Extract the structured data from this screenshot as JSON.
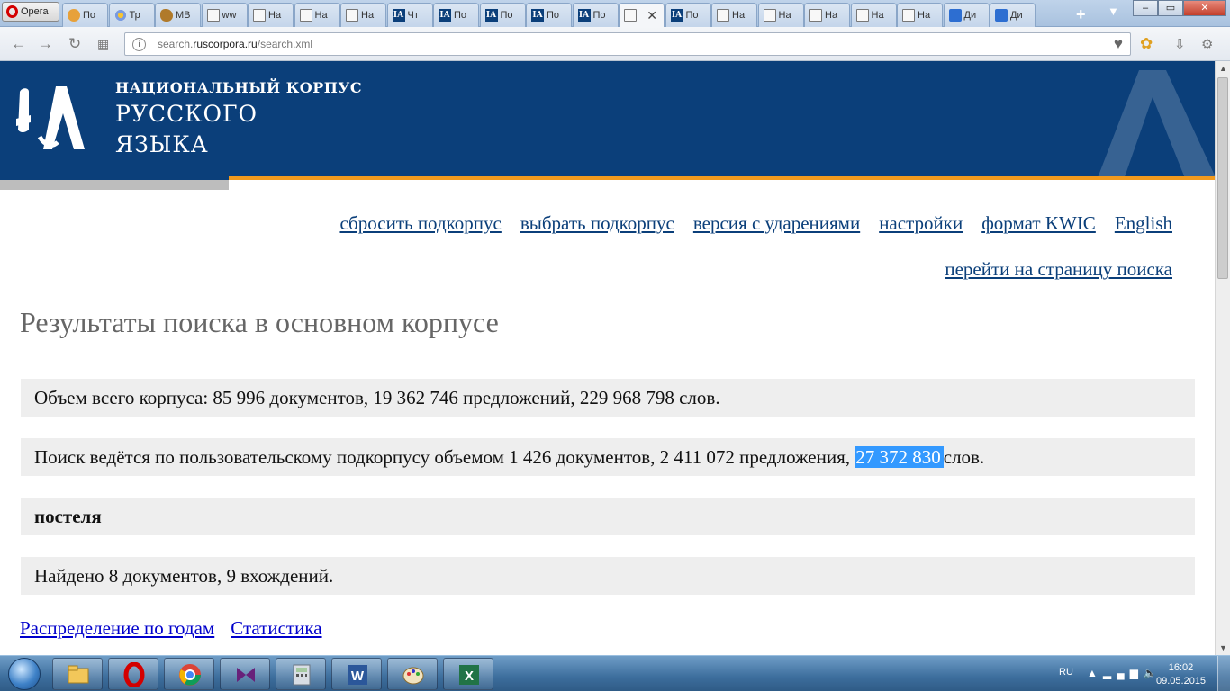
{
  "browser": {
    "menu_label": "Opera",
    "tabs": [
      {
        "title": "По",
        "icon": "orange"
      },
      {
        "title": "Тр",
        "icon": "flower"
      },
      {
        "title": "МВ",
        "icon": "squirrel"
      },
      {
        "title": "ww",
        "icon": "page"
      },
      {
        "title": "На",
        "icon": "page"
      },
      {
        "title": "На",
        "icon": "page"
      },
      {
        "title": "На",
        "icon": "page"
      },
      {
        "title": "Чт",
        "icon": "ruscorp"
      },
      {
        "title": "По",
        "icon": "ruscorp"
      },
      {
        "title": "По",
        "icon": "ruscorp"
      },
      {
        "title": "По",
        "icon": "ruscorp"
      },
      {
        "title": "По",
        "icon": "ruscorp"
      },
      {
        "title": "",
        "icon": "page",
        "active": true
      },
      {
        "title": "По",
        "icon": "ruscorp"
      },
      {
        "title": "На",
        "icon": "page"
      },
      {
        "title": "На",
        "icon": "page"
      },
      {
        "title": "На",
        "icon": "page"
      },
      {
        "title": "На",
        "icon": "page"
      },
      {
        "title": "На",
        "icon": "page"
      },
      {
        "title": "Ди",
        "icon": "chat"
      },
      {
        "title": "Ди",
        "icon": "chat"
      }
    ],
    "url_prefix": "search.",
    "url_domain": "ruscorpora.ru",
    "url_path": "/search.xml",
    "window_controls": [
      "–",
      "▭",
      "✕"
    ]
  },
  "site": {
    "logo_line1": "НАЦИОНАЛЬНЫЙ КОРПУС",
    "logo_line2": "РУССКОГО",
    "logo_line3": "ЯЗЫКА",
    "brand_color": "#0b3f7a",
    "accent_color": "#f29a1d"
  },
  "nav": {
    "links": [
      "сбросить подкорпус",
      "выбрать подкорпус",
      "версия с ударениями",
      "настройки",
      "формат KWIC",
      "English"
    ],
    "search_page_link": "перейти на страницу поиска"
  },
  "results": {
    "title": "Результаты поиска в основном корпусе",
    "corpus_size": "Объем всего корпуса: 85 996 документов, 19 362 746 предложений, 229 968 798 слов.",
    "subcorpus_prefix": "Поиск ведётся по пользовательскому подкорпусу объемом 1 426 документов, 2 411 072 предложения, ",
    "subcorpus_words": "27 372 830",
    "subcorpus_suffix": "слов.",
    "query": "постеля",
    "found": "Найдено 8 документов, 9 вхождений.",
    "link_years": "Распределение по годам",
    "link_stats": "Статистика"
  },
  "taskbar": {
    "apps": [
      "explorer",
      "opera",
      "chrome",
      "visual-studio",
      "calculator",
      "word",
      "paint",
      "excel"
    ],
    "lang": "RU",
    "time": "16:02",
    "date": "09.05.2015"
  }
}
